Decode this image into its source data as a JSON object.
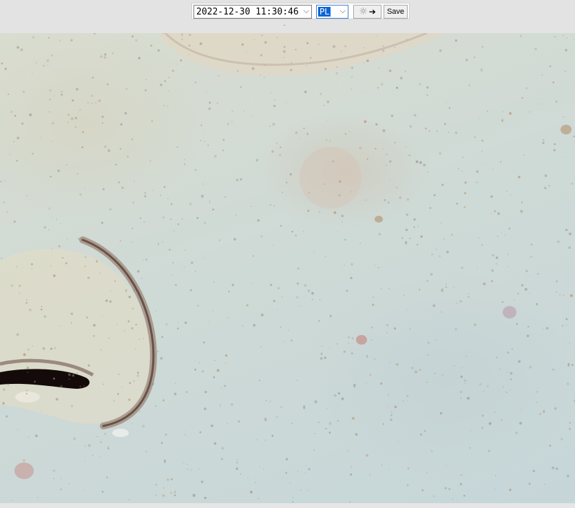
{
  "toolbar": {
    "datetime_value": "2022-12-30 11:30:46",
    "mode_value": "PL",
    "light_toggle_icon": "sun-arrow-icon",
    "save_label": "Save"
  },
  "viewer": {
    "image_subject": "skin-closeup"
  },
  "colors": {
    "selection_blue": "#0a64d6",
    "toolbar_bg": "#e3e3e3"
  }
}
